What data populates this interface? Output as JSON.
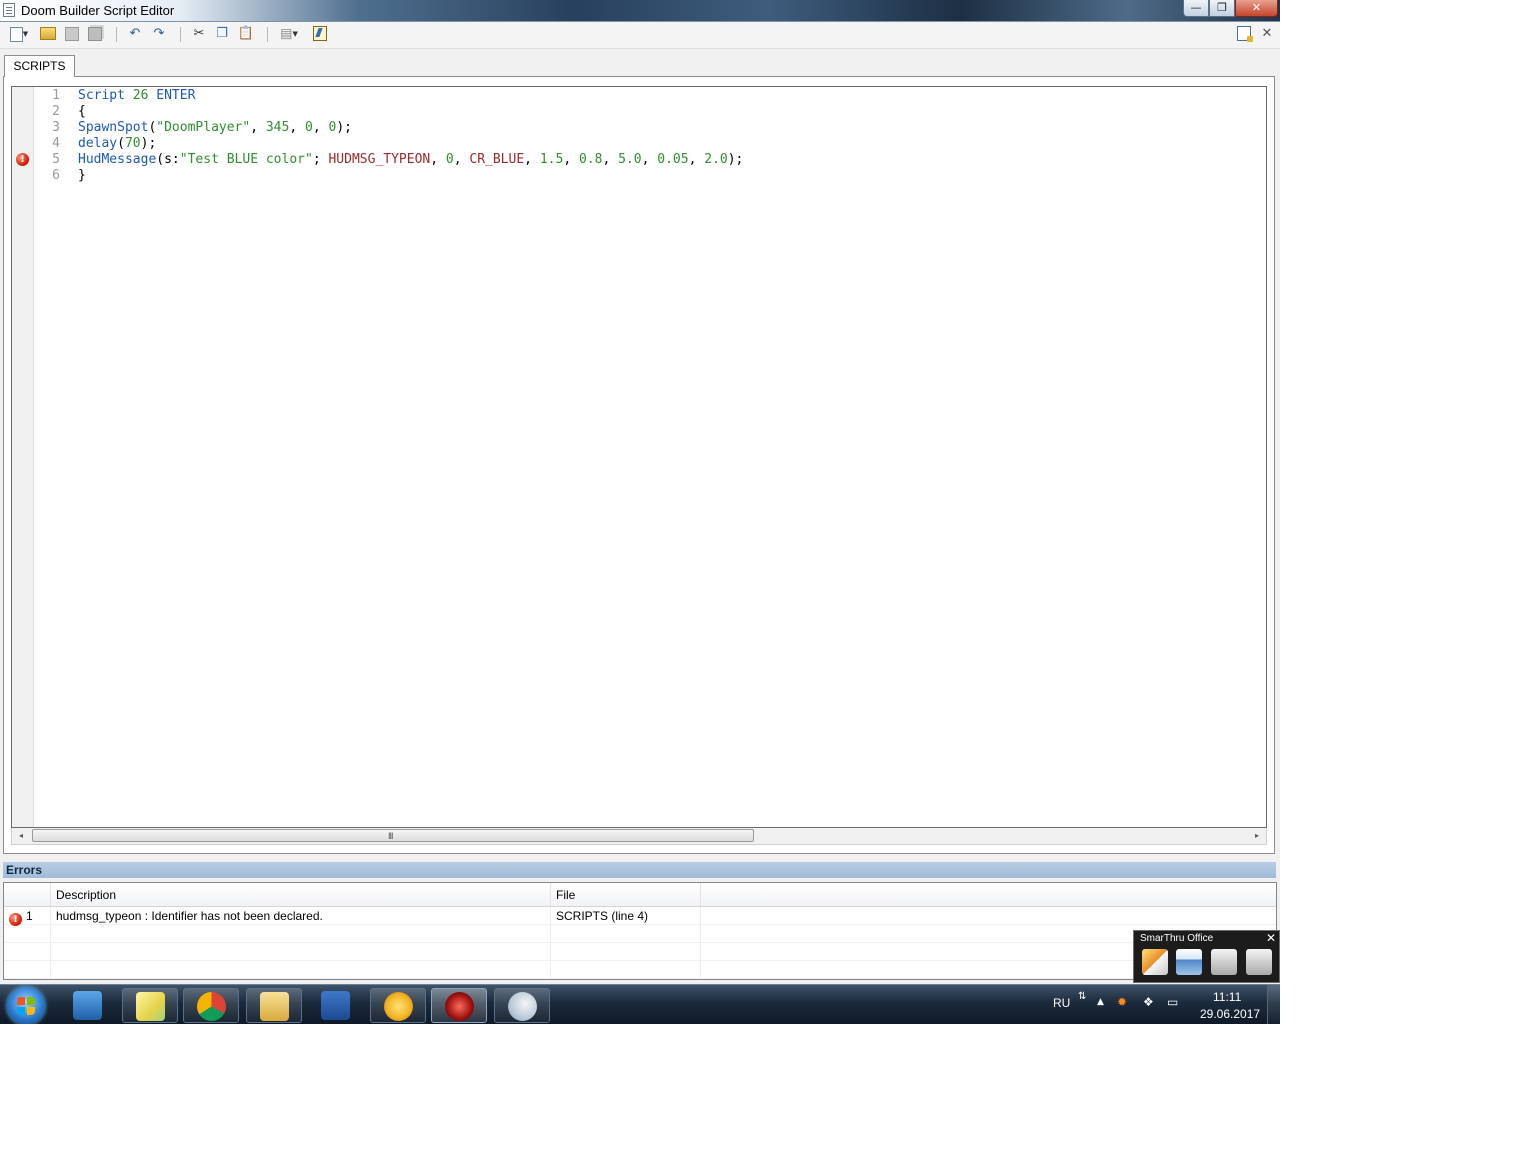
{
  "window": {
    "title": "Doom Builder Script Editor",
    "controls": {
      "minimize": "—",
      "maximize": "❐",
      "close": "✕"
    }
  },
  "toolbar": {
    "close_glyph": "✕",
    "icons": [
      "new-script-icon",
      "open-icon",
      "save-icon",
      "save-all-icon",
      "undo-icon",
      "redo-icon",
      "cut-icon",
      "copy-icon",
      "paste-icon",
      "script-config-icon",
      "compile-icon",
      "script-help-icon",
      "close-icon"
    ]
  },
  "tabs": [
    {
      "label": "SCRIPTS"
    }
  ],
  "editor": {
    "lines": [
      {
        "number": "1",
        "tokens": [
          [
            "kw",
            "Script"
          ],
          [
            "punct",
            " "
          ],
          [
            "num",
            "26"
          ],
          [
            "punct",
            " "
          ],
          [
            "kw",
            "ENTER"
          ]
        ]
      },
      {
        "number": "2",
        "tokens": [
          [
            "punct",
            "{"
          ]
        ]
      },
      {
        "number": "3",
        "tokens": [
          [
            "fn",
            "SpawnSpot"
          ],
          [
            "punct",
            "("
          ],
          [
            "str",
            "\"DoomPlayer\""
          ],
          [
            "punct",
            ", "
          ],
          [
            "num",
            "345"
          ],
          [
            "punct",
            ", "
          ],
          [
            "num",
            "0"
          ],
          [
            "punct",
            ", "
          ],
          [
            "num",
            "0"
          ],
          [
            "punct",
            ");"
          ]
        ]
      },
      {
        "number": "4",
        "tokens": [
          [
            "fn",
            "delay"
          ],
          [
            "punct",
            "("
          ],
          [
            "num",
            "70"
          ],
          [
            "punct",
            ");"
          ]
        ]
      },
      {
        "number": "5",
        "error": true,
        "tokens": [
          [
            "fn",
            "HudMessage"
          ],
          [
            "punct",
            "(s:"
          ],
          [
            "str",
            "\"Test BLUE color\""
          ],
          [
            "punct",
            "; "
          ],
          [
            "cst",
            "HUDMSG_TYPEON"
          ],
          [
            "punct",
            ", "
          ],
          [
            "num",
            "0"
          ],
          [
            "punct",
            ", "
          ],
          [
            "cst",
            "CR_BLUE"
          ],
          [
            "punct",
            ", "
          ],
          [
            "num",
            "1.5"
          ],
          [
            "punct",
            ", "
          ],
          [
            "num",
            "0.8"
          ],
          [
            "punct",
            ", "
          ],
          [
            "num",
            "5.0"
          ],
          [
            "punct",
            ", "
          ],
          [
            "num",
            "0.05"
          ],
          [
            "punct",
            ", "
          ],
          [
            "num",
            "2.0"
          ],
          [
            "punct",
            ");"
          ]
        ]
      },
      {
        "number": "6",
        "tokens": [
          [
            "punct",
            "}"
          ]
        ]
      }
    ],
    "error_marker": "!",
    "scroll": {
      "left": "◂",
      "right": "▸",
      "grip": "III"
    }
  },
  "errors": {
    "title": "Errors",
    "columns": [
      "",
      "Description",
      "File"
    ],
    "rows": [
      {
        "index": "1",
        "description": "hudmsg_typeon : Identifier has not been declared.",
        "file": "SCRIPTS (line 4)"
      }
    ]
  },
  "smarthru": {
    "title": "SmarThru Office",
    "close": "✕"
  },
  "taskbar": {
    "apps": [
      "media-player-icon",
      "sticky-notes-icon",
      "chrome-icon",
      "file-explorer-icon",
      "word-icon",
      "1c-icon",
      "doom-builder-icon",
      "paint-icon"
    ],
    "tray": {
      "language": "RU",
      "time": "11:11",
      "date": "29.06.2017",
      "expand": "▲"
    }
  },
  "colors": {
    "keyword": "#1d59b5",
    "number": "#2f8f2f",
    "constant": "#9a2b2b",
    "error": "#d8220b",
    "panel_header": "#9fbbd8"
  }
}
